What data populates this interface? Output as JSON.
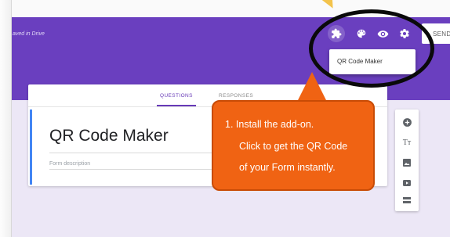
{
  "header": {
    "saved_status": "aved in Drive",
    "send_label": "SEND",
    "icons": [
      "puzzle-icon",
      "palette-icon",
      "eye-icon",
      "gear-icon"
    ],
    "accent_color": "#6a3fbf"
  },
  "addon_menu": {
    "items": [
      {
        "label": "QR Code Maker"
      }
    ]
  },
  "tabs": [
    {
      "label": "QUESTIONS",
      "active": true
    },
    {
      "label": "RESPONSES",
      "active": false
    }
  ],
  "form": {
    "title": "QR Code Maker",
    "description_placeholder": "Form description"
  },
  "side_toolbar": {
    "text_tool_label": "Tт",
    "icons": [
      "add-circle-icon",
      "title-text-icon",
      "image-icon",
      "video-icon",
      "section-icon"
    ]
  },
  "callout": {
    "color": "#f06313",
    "lines": [
      "1.  Install the add-on.",
      "Click to get the QR Code",
      "of your Form instantly."
    ]
  }
}
